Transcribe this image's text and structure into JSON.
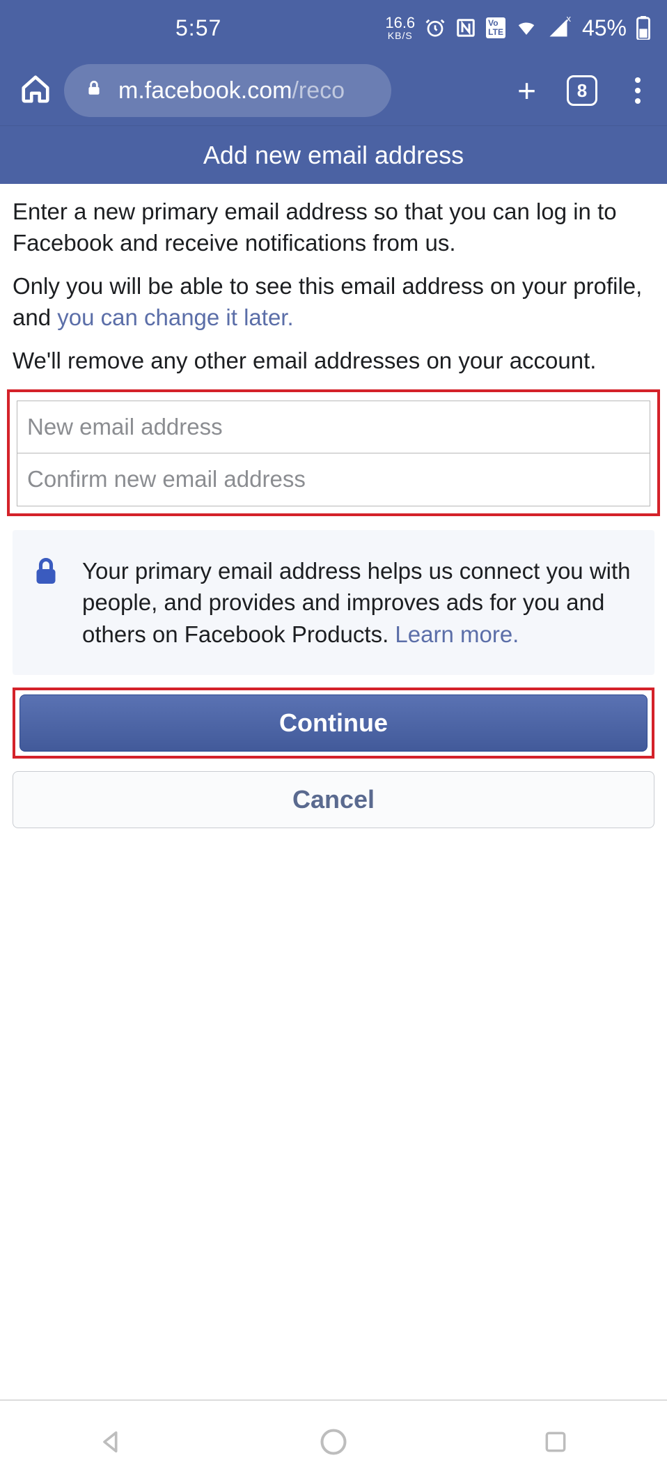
{
  "statusbar": {
    "time": "5:57",
    "speed_value": "16.6",
    "speed_unit": "KB/S",
    "volte": "Vo LTE",
    "battery_pct": "45%"
  },
  "chrome": {
    "url_host": "m.facebook.com",
    "url_path": "/reco",
    "tab_count": "8"
  },
  "page": {
    "title": "Add new email address",
    "para1": "Enter a new primary email address so that you can log in to Facebook and receive notifications from us.",
    "para2_a": "Only you will be able to see this email address on your profile, and ",
    "para2_link": "you can change it later.",
    "para3": "We'll remove any other email addresses on your account.",
    "placeholder_new": "New email address",
    "placeholder_confirm": "Confirm new email address",
    "info_text": "Your primary email address helps us connect you with people, and provides and improves ads for you and others on Facebook Products. ",
    "info_link": "Learn more.",
    "continue": "Continue",
    "cancel": "Cancel"
  }
}
